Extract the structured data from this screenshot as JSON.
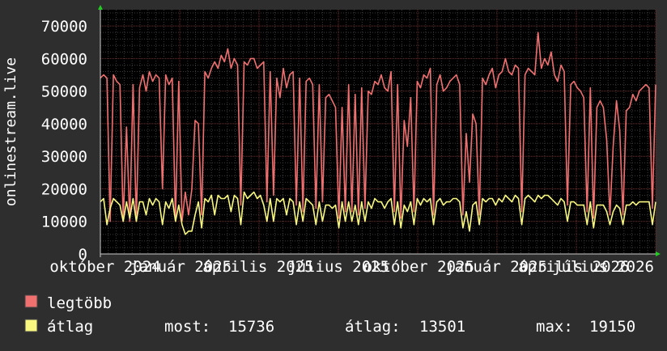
{
  "chart_data": {
    "type": "line",
    "ylabel": "onlinestream.live",
    "ylim": [
      0,
      75000
    ],
    "yticks": [
      0,
      10000,
      20000,
      30000,
      40000,
      50000,
      60000,
      70000
    ],
    "ytick_labels": [
      "0",
      "10000",
      "20000",
      "30000",
      "40000",
      "50000",
      "60000",
      "70000"
    ],
    "x_tick_labels": [
      "október 2024",
      "január 2025",
      "április 2025",
      "július 2025",
      "október 2025",
      "január 2025",
      "április 2026",
      "július 2026"
    ],
    "x_tick_positions": [
      0,
      0.145,
      0.285,
      0.43,
      0.575,
      0.715,
      0.855,
      1.0
    ],
    "grid": true,
    "series": [
      {
        "name": "legtöbb",
        "color": "#f07070",
        "values": [
          54000,
          55000,
          54000,
          10000,
          55000,
          53000,
          52000,
          10000,
          39000,
          10000,
          52000,
          10000,
          51000,
          55000,
          50000,
          56000,
          53000,
          55000,
          54000,
          20000,
          55000,
          52000,
          54000,
          10000,
          53000,
          10000,
          19000,
          12000,
          20000,
          41000,
          40000,
          12000,
          56000,
          54000,
          57000,
          59000,
          57000,
          61000,
          59000,
          63000,
          57000,
          60000,
          58000,
          15000,
          59000,
          58000,
          60000,
          60000,
          57000,
          58000,
          59000,
          16000,
          56000,
          18000,
          54000,
          48000,
          57000,
          51000,
          55000,
          56000,
          15000,
          54000,
          13000,
          53000,
          54000,
          52000,
          14000,
          52000,
          16000,
          48000,
          49000,
          47000,
          45000,
          11000,
          45000,
          13000,
          52000,
          13000,
          49000,
          12000,
          51000,
          14000,
          50000,
          49000,
          53000,
          52000,
          55000,
          51000,
          50000,
          56000,
          13000,
          52000,
          11000,
          41000,
          33000,
          48000,
          13000,
          53000,
          51000,
          55000,
          54000,
          57000,
          12000,
          52000,
          55000,
          50000,
          51000,
          53000,
          54000,
          55000,
          52000,
          12000,
          37000,
          22000,
          43000,
          40000,
          12000,
          54000,
          52000,
          55000,
          57000,
          51000,
          55000,
          56000,
          60000,
          56000,
          55000,
          58000,
          57000,
          13000,
          55000,
          57000,
          56000,
          55000,
          68000,
          57000,
          60000,
          58000,
          62000,
          55000,
          53000,
          58000,
          56000,
          15000,
          52000,
          53000,
          51000,
          50000,
          48000,
          13000,
          51000,
          11000,
          45000,
          47000,
          45000,
          35000,
          12000,
          33000,
          47000,
          38000,
          12000,
          44000,
          45000,
          49000,
          47000,
          50000,
          51000,
          52000,
          51000,
          14000,
          52000
        ],
        "color_name": "salmon"
      },
      {
        "name": "átlag",
        "color": "#f8f880",
        "values": [
          16000,
          17000,
          9000,
          14000,
          17000,
          16000,
          15000,
          10000,
          16000,
          11000,
          17000,
          10000,
          16000,
          16000,
          12000,
          17000,
          15000,
          17000,
          16000,
          9000,
          16000,
          14000,
          17000,
          10000,
          15000,
          9000,
          6000,
          7000,
          7000,
          12000,
          16000,
          8000,
          17000,
          16000,
          18000,
          12000,
          18000,
          17000,
          17000,
          18000,
          13000,
          18000,
          17000,
          9000,
          19000,
          17000,
          18000,
          19000,
          17000,
          18000,
          15000,
          10000,
          17000,
          10000,
          17000,
          16000,
          17000,
          12000,
          17000,
          16000,
          9000,
          16000,
          10000,
          17000,
          16000,
          15000,
          9000,
          16000,
          10000,
          15000,
          15000,
          14000,
          15000,
          8000,
          16000,
          10000,
          16000,
          10000,
          15000,
          9000,
          16000,
          10000,
          16000,
          14000,
          17000,
          16000,
          16000,
          14000,
          16000,
          17000,
          9000,
          16000,
          8000,
          15000,
          13000,
          16000,
          9000,
          17000,
          15000,
          17000,
          16000,
          17000,
          9000,
          16000,
          17000,
          15000,
          16000,
          16000,
          17000,
          17000,
          16000,
          8000,
          13000,
          7000,
          15000,
          16000,
          9000,
          17000,
          16000,
          17000,
          17000,
          15000,
          17000,
          16000,
          18000,
          17000,
          16000,
          18000,
          17000,
          9000,
          17000,
          18000,
          17000,
          16000,
          18000,
          17000,
          18000,
          18000,
          17000,
          16000,
          15000,
          17000,
          16000,
          10000,
          16000,
          16000,
          15000,
          15000,
          15000,
          9000,
          16000,
          8000,
          15000,
          15000,
          15000,
          13000,
          9000,
          13000,
          15000,
          14000,
          9000,
          15000,
          15000,
          16000,
          15000,
          16000,
          16000,
          16000,
          16000,
          9000,
          16000
        ],
        "color_name": "pale-yellow"
      }
    ],
    "legend": [
      {
        "label": "legtöbb",
        "color": "#f07070"
      },
      {
        "label": "átlag",
        "color": "#f8f880"
      }
    ],
    "stats": {
      "now_label": "most:",
      "now_value": "15736",
      "avg_label": "átlag:",
      "avg_value": "13501",
      "max_label": "max:",
      "max_value": "19150"
    }
  }
}
